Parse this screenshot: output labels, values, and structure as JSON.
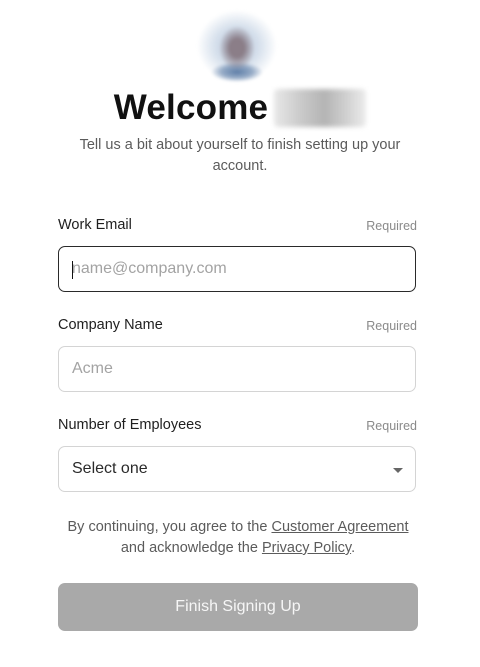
{
  "header": {
    "welcome": "Welcome",
    "subtitle": "Tell us a bit about yourself to finish setting up your account."
  },
  "fields": {
    "email": {
      "label": "Work Email",
      "required": "Required",
      "placeholder": "name@company.com",
      "value": ""
    },
    "company": {
      "label": "Company Name",
      "required": "Required",
      "placeholder": "Acme",
      "value": ""
    },
    "employees": {
      "label": "Number of Employees",
      "required": "Required",
      "selected": "Select one"
    }
  },
  "legal": {
    "prefix": "By continuing, you agree to the",
    "agreement_link": "Customer Agreement",
    "middle": "and acknowledge the",
    "privacy_link": "Privacy Policy",
    "suffix": "."
  },
  "submit": {
    "label": "Finish Signing Up",
    "color": "#a9a9a9"
  }
}
